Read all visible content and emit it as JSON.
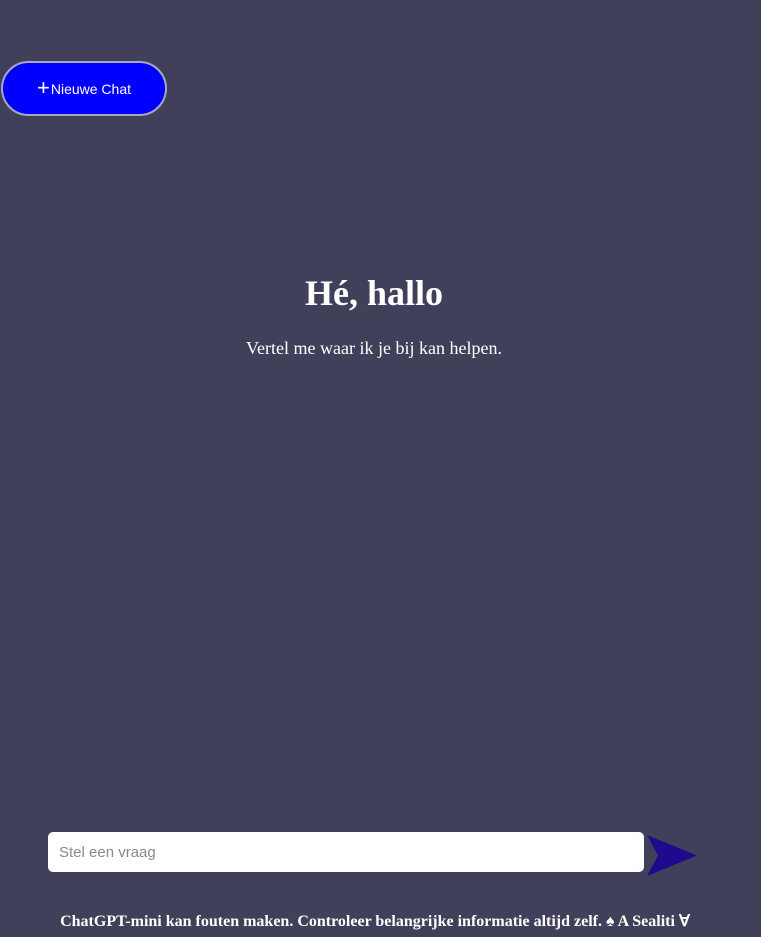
{
  "header": {
    "new_chat_label": "Nieuwe Chat",
    "new_chat_icon": "plus-icon",
    "new_chat_color": "#0000ff"
  },
  "hero": {
    "title": "Hé, hallo",
    "subtitle": "Vertel me waar ik je bij kan helpen."
  },
  "composer": {
    "placeholder": "Stel een vraag",
    "value": "",
    "send_icon": "send-arrow-icon",
    "send_color": "#1e0a8c"
  },
  "footer": {
    "disclaimer": "ChatGPT-mini kan fouten maken. Controleer belangrijke informatie altijd zelf. ♠ A Sealiti ∀"
  },
  "theme": {
    "background": "#40405a"
  }
}
